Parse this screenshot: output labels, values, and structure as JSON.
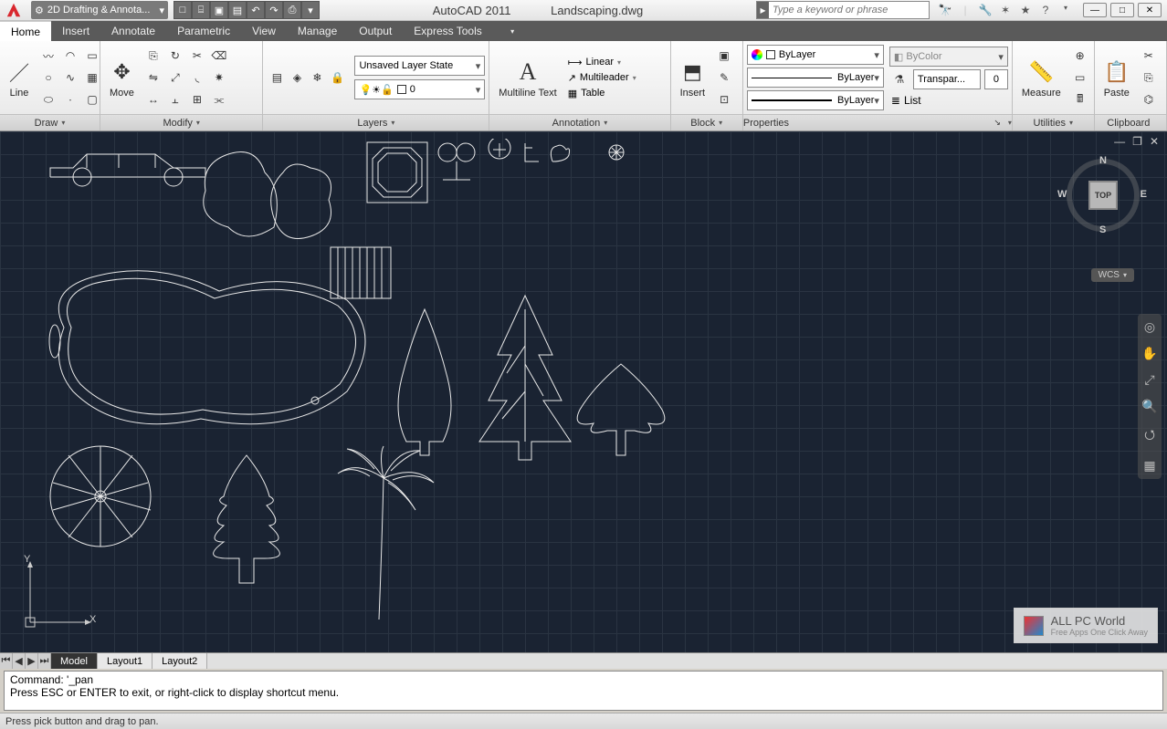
{
  "app": {
    "name": "AutoCAD 2011",
    "file": "Landscaping.dwg"
  },
  "workspace_selector": "2D Drafting & Annota...",
  "search_placeholder": "Type a keyword or phrase",
  "menu_tabs": [
    "Home",
    "Insert",
    "Annotate",
    "Parametric",
    "View",
    "Manage",
    "Output",
    "Express Tools"
  ],
  "ribbon": {
    "draw": {
      "title": "Draw",
      "line_label": "Line"
    },
    "modify": {
      "title": "Modify",
      "move_label": "Move"
    },
    "layers": {
      "title": "Layers",
      "state": "Unsaved Layer State",
      "current": "0"
    },
    "annotation": {
      "title": "Annotation",
      "multiline": "Multiline Text",
      "items": [
        "Linear",
        "Multileader",
        "Table"
      ]
    },
    "block": {
      "title": "Block",
      "insert_label": "Insert"
    },
    "properties": {
      "title": "Properties",
      "color": "ByLayer",
      "linetype": "ByLayer",
      "lineweight": "ByLayer",
      "bycolor": "ByColor",
      "transp_label": "Transpar...",
      "transp_value": "0",
      "list": "List"
    },
    "utilities": {
      "title": "Utilities",
      "measure": "Measure"
    },
    "clipboard": {
      "title": "Clipboard",
      "paste": "Paste"
    }
  },
  "viewcube": {
    "top": "TOP",
    "n": "N",
    "s": "S",
    "e": "E",
    "w": "W"
  },
  "wcs": "WCS",
  "ucs": {
    "x": "X",
    "y": "Y"
  },
  "layout_tabs": [
    "Model",
    "Layout1",
    "Layout2"
  ],
  "command": {
    "line1": "Command: '_pan",
    "line2": "Press ESC or ENTER to exit, or right-click to display shortcut menu."
  },
  "status": "Press pick button and drag to pan.",
  "watermark": {
    "title": "ALL PC World",
    "sub": "Free Apps One Click Away"
  }
}
